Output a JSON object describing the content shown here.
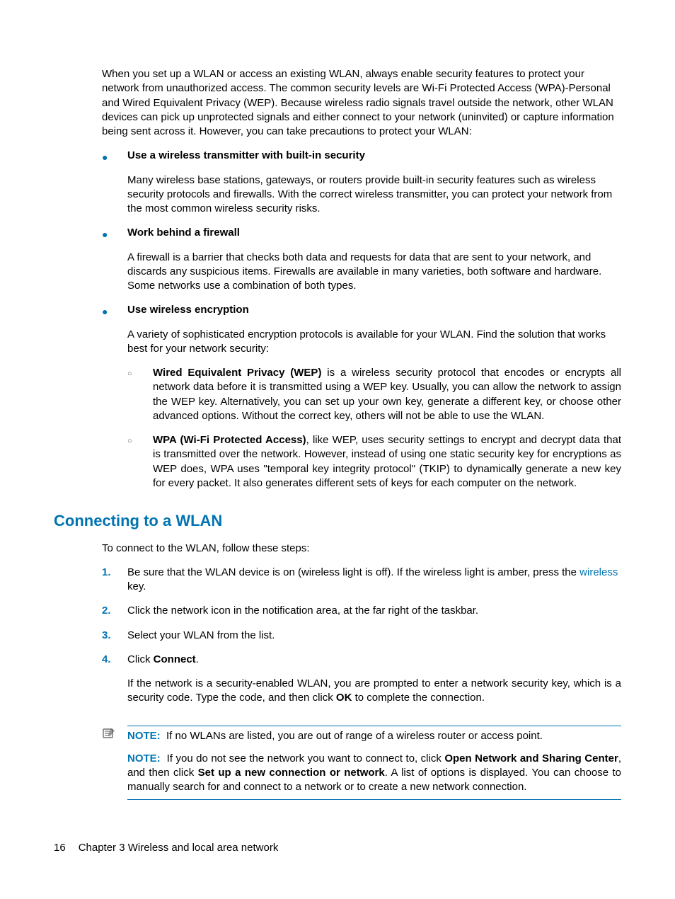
{
  "intro": "When you set up a WLAN or access an existing WLAN, always enable security features to protect your network from unauthorized access. The common security levels are Wi-Fi Protected Access (WPA)-Personal and Wired Equivalent Privacy (WEP). Because wireless radio signals travel outside the network, other WLAN devices can pick up unprotected signals and either connect to your network (uninvited) or capture information being sent across it. However, you can take precautions to protect your WLAN:",
  "bullets": [
    {
      "title": "Use a wireless transmitter with built-in security",
      "body": "Many wireless base stations, gateways, or routers provide built-in security features such as wireless security protocols and firewalls. With the correct wireless transmitter, you can protect your network from the most common wireless security risks."
    },
    {
      "title": "Work behind a firewall",
      "body": "A firewall is a barrier that checks both data and requests for data that are sent to your network, and discards any suspicious items. Firewalls are available in many varieties, both software and hardware. Some networks use a combination of both types."
    },
    {
      "title": "Use wireless encryption",
      "body": "A variety of sophisticated encryption protocols is available for your WLAN. Find the solution that works best for your network security:",
      "subs": [
        {
          "bold": "Wired Equivalent Privacy (WEP)",
          "rest": " is a wireless security protocol that encodes or encrypts all network data before it is transmitted using a WEP key. Usually, you can allow the network to assign the WEP key. Alternatively, you can set up your own key, generate a different key, or choose other advanced options. Without the correct key, others will not be able to use the WLAN."
        },
        {
          "bold": "WPA (Wi-Fi Protected Access)",
          "rest": ", like WEP, uses security settings to encrypt and decrypt data that is transmitted over the network. However, instead of using one static security key for encryptions as WEP does, WPA uses \"temporal key integrity protocol\" (TKIP) to dynamically generate a new key for every packet. It also generates different sets of keys for each computer on the network."
        }
      ]
    }
  ],
  "section_heading": "Connecting to a WLAN",
  "section_intro": "To connect to the WLAN, follow these steps:",
  "steps": {
    "s1_pre": "Be sure that the WLAN device is on (wireless light is off). If the wireless light is amber, press the ",
    "s1_link": "wireless",
    "s1_post": " key.",
    "s2": "Click the network icon in the notification area, at the far right of the taskbar.",
    "s3": "Select your WLAN from the list.",
    "s4_pre": "Click ",
    "s4_bold": "Connect",
    "s4_post": ".",
    "s4_extra_pre": "If the network is a security-enabled WLAN, you are prompted to enter a network security key, which is a security code. Type the code, and then click ",
    "s4_extra_bold": "OK",
    "s4_extra_post": " to complete the connection."
  },
  "notes": {
    "label": "NOTE:",
    "n1": "If no WLANs are listed, you are out of range of a wireless router or access point.",
    "n2_pre": "If you do not see the network you want to connect to, click ",
    "n2_b1": "Open Network and Sharing Center",
    "n2_mid": ", and then click ",
    "n2_b2": "Set up a new connection or network",
    "n2_post": ". A list of options is displayed. You can choose to manually search for and connect to a network or to create a new network connection."
  },
  "footer": {
    "page": "16",
    "chapter": "Chapter 3   Wireless and local area network"
  }
}
